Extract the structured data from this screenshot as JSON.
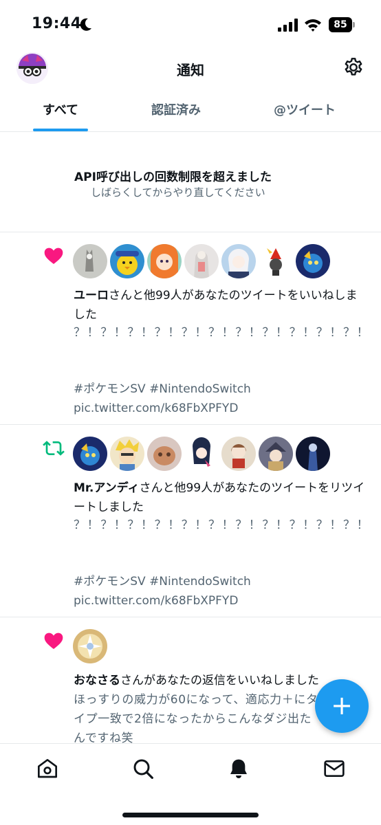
{
  "status_bar": {
    "time": "19:44",
    "battery": "85"
  },
  "header": {
    "title": "通知"
  },
  "tabs": [
    {
      "label": "すべて"
    },
    {
      "label": "認証済み"
    },
    {
      "label": "@ツイート"
    }
  ],
  "tabs_active_index": 0,
  "rate_limit": {
    "title": "API呼び出しの回数制限を超えました",
    "subtitle": "しばらくしてからやり直してください"
  },
  "notifications": [
    {
      "type": "like",
      "actor": "ユーロ",
      "text": "さんと他99人があなたのツイートをいいねしました",
      "body_line1": "？！？！？！？！？！？！？！？！？！？！？！",
      "hashtags": " #ポケモンSV #NintendoSwitch",
      "link": "pic.twitter.com/k68FbXPFYD"
    },
    {
      "type": "retweet",
      "actor": "Mr.アンディ",
      "text": "さんと他99人があなたのツイートをリツイートしました",
      "body_line1": "？！？！？！？！？！？！？！？！？！？！？！",
      "hashtags": " #ポケモンSV #NintendoSwitch",
      "link": "pic.twitter.com/k68FbXPFYD"
    },
    {
      "type": "like",
      "actor": "おなさる",
      "text": "さんがあなたの返信をいいねしました",
      "body": "ほっすりの威力が60になって、適応力＋にタイプ一致で2倍になったからこんなダジ出たんですね笑"
    }
  ],
  "fab": {
    "label": "+"
  },
  "colors": {
    "accent": "#1d9bf0",
    "like": "#f91880",
    "retweet": "#00ba7c",
    "secondary_text": "#536471"
  },
  "icons": {
    "settings": "gear-icon",
    "home": "home-icon",
    "search": "search-icon",
    "notifications": "bell-icon",
    "messages": "mail-icon"
  }
}
